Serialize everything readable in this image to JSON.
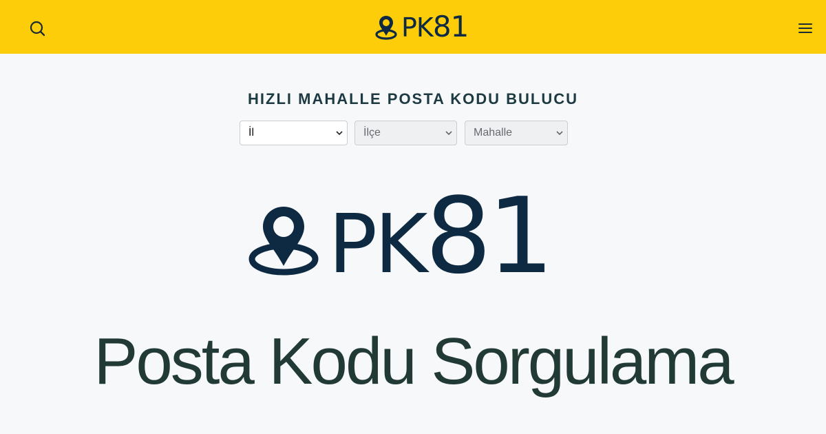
{
  "header": {
    "logo_prefix": "PK",
    "logo_number": "81",
    "search_icon": "search-icon",
    "menu_icon": "hamburger-menu-icon",
    "background_color": "#fdcd09"
  },
  "finder": {
    "title": "HIZLI MAHALLE POSTA KODU BULUCU",
    "selects": {
      "il": {
        "value": "İl",
        "enabled": true
      },
      "ilce": {
        "value": "İlçe",
        "enabled": false
      },
      "mahalle": {
        "value": "Mahalle",
        "enabled": false
      }
    }
  },
  "hero": {
    "logo_prefix": "PK",
    "logo_number": "81",
    "tagline": "Posta Kodu Sorgulama",
    "logo_color": "#0d2a42",
    "tagline_color": "#223a35"
  }
}
